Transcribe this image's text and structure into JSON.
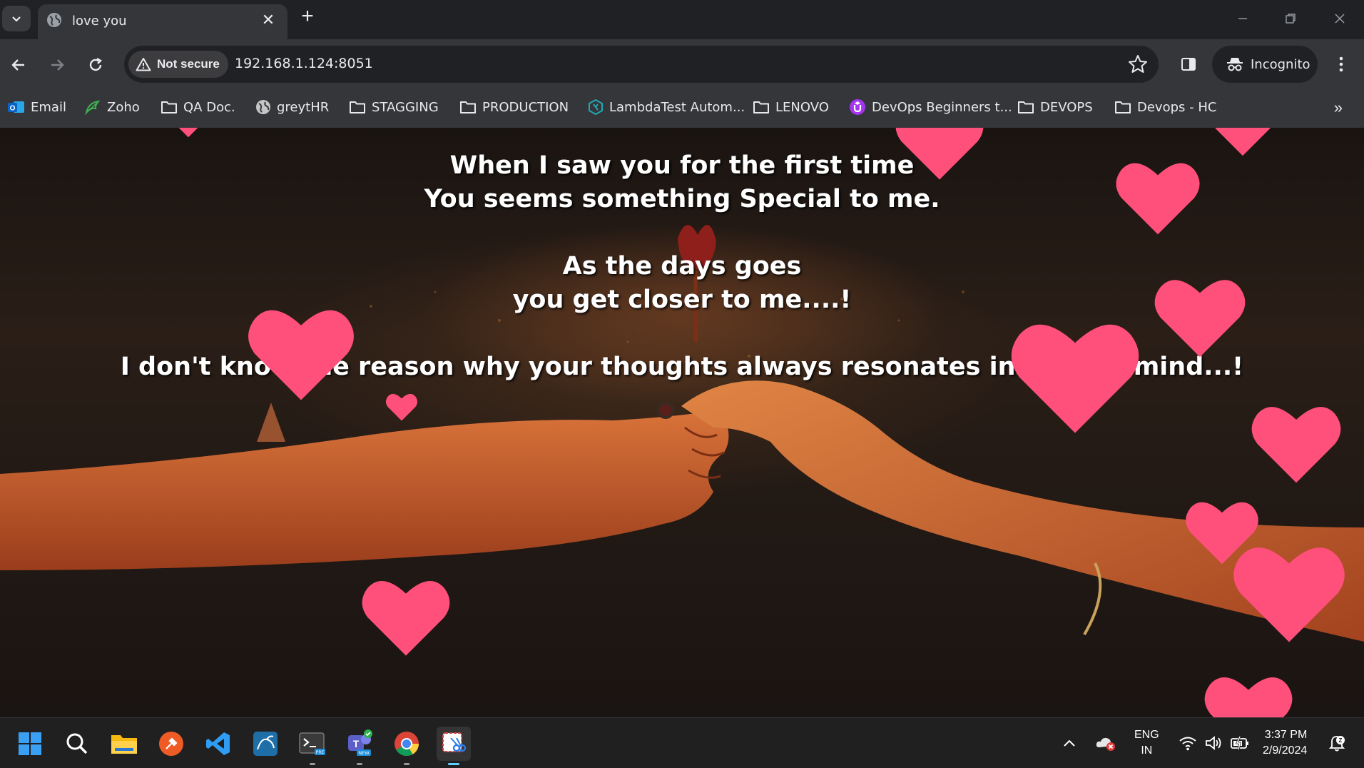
{
  "browser": {
    "tab_title": "love you",
    "security_label": "Not secure",
    "url": "192.168.1.124:8051",
    "incognito_label": "Incognito",
    "bookmarks": [
      {
        "label": "Email",
        "icon": "outlook-icon"
      },
      {
        "label": "Zoho",
        "icon": "zoho-icon"
      },
      {
        "label": "QA Doc.",
        "icon": "folder-icon"
      },
      {
        "label": "greytHR",
        "icon": "globe-icon"
      },
      {
        "label": "STAGGING",
        "icon": "folder-icon"
      },
      {
        "label": "PRODUCTION",
        "icon": "folder-icon"
      },
      {
        "label": "LambdaTest Autom...",
        "icon": "lambdatest-icon"
      },
      {
        "label": "LENOVO",
        "icon": "folder-icon"
      },
      {
        "label": "DevOps Beginners t...",
        "icon": "udemy-icon"
      },
      {
        "label": "DEVOPS",
        "icon": "folder-icon"
      },
      {
        "label": "Devops - HC",
        "icon": "folder-icon"
      }
    ]
  },
  "page": {
    "poem": {
      "line1": "When I saw you for the first time",
      "line2": "You seems something Special to me.",
      "line3": "As the days goes",
      "line4": "you get closer to me....!",
      "line5": "I don't know the reason why your thoughts always resonates inside my mind...!"
    },
    "heart_color": "#ff4f7b"
  },
  "taskbar": {
    "apps": [
      "start-icon",
      "search-icon",
      "file-explorer-icon",
      "postman-icon",
      "vscode-icon",
      "mysql-workbench-icon",
      "terminal-preview-icon",
      "teams-new-icon",
      "chrome-icon",
      "snipping-tool-icon"
    ],
    "language": "ENG",
    "region": "IN",
    "time": "3:37 PM",
    "date": "2/9/2024"
  }
}
